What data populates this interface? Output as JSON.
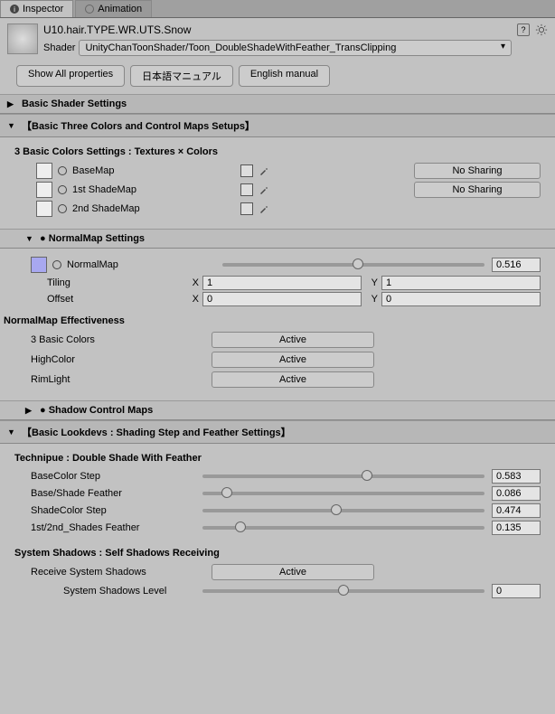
{
  "tabs": {
    "inspector": "Inspector",
    "animation": "Animation"
  },
  "title": "U10.hair.TYPE.WR.UTS.Snow",
  "shaderLabel": "Shader",
  "shaderValue": "UnityChanToonShader/Toon_DoubleShadeWithFeather_TransClipping",
  "buttons": {
    "showAll": "Show All properties",
    "jpManual": "日本語マニュアル",
    "enManual": "English manual"
  },
  "sections": {
    "basicShader": "Basic Shader Settings",
    "threeColors": "【Basic Three Colors and Control Maps Setups】",
    "normalMap": "● NormalMap Settings",
    "shadowControl": "● Shadow Control Maps",
    "lookdevs": "【Basic Lookdevs : Shading Step and Feather Settings】"
  },
  "threeColors": {
    "heading": "3 Basic Colors Settings : Textures × Colors",
    "baseMap": "BaseMap",
    "firstShade": "1st ShadeMap",
    "secondShade": "2nd ShadeMap",
    "noSharing": "No Sharing"
  },
  "normalMap": {
    "label": "NormalMap",
    "value": "0.516",
    "tiling": "Tiling",
    "offset": "Offset",
    "tilingX": "1",
    "tilingY": "1",
    "offsetX": "0",
    "offsetY": "0",
    "effHeading": "NormalMap Effectiveness",
    "eff1": "3 Basic Colors",
    "eff2": "HighColor",
    "eff3": "RimLight",
    "active": "Active"
  },
  "technique": {
    "heading": "Technipue : Double Shade With Feather",
    "baseColorStep": {
      "label": "BaseColor Step",
      "value": "0.583"
    },
    "baseShade": {
      "label": "Base/Shade Feather",
      "value": "0.086"
    },
    "shadeColorStep": {
      "label": "ShadeColor Step",
      "value": "0.474"
    },
    "shadesFeather": {
      "label": "1st/2nd_Shades Feather",
      "value": "0.135"
    }
  },
  "systemShadows": {
    "heading": "System Shadows : Self Shadows Receiving",
    "receive": "Receive System Shadows",
    "active": "Active",
    "level": "System Shadows Level",
    "levelValue": "0"
  },
  "xy": {
    "x": "X",
    "y": "Y"
  }
}
